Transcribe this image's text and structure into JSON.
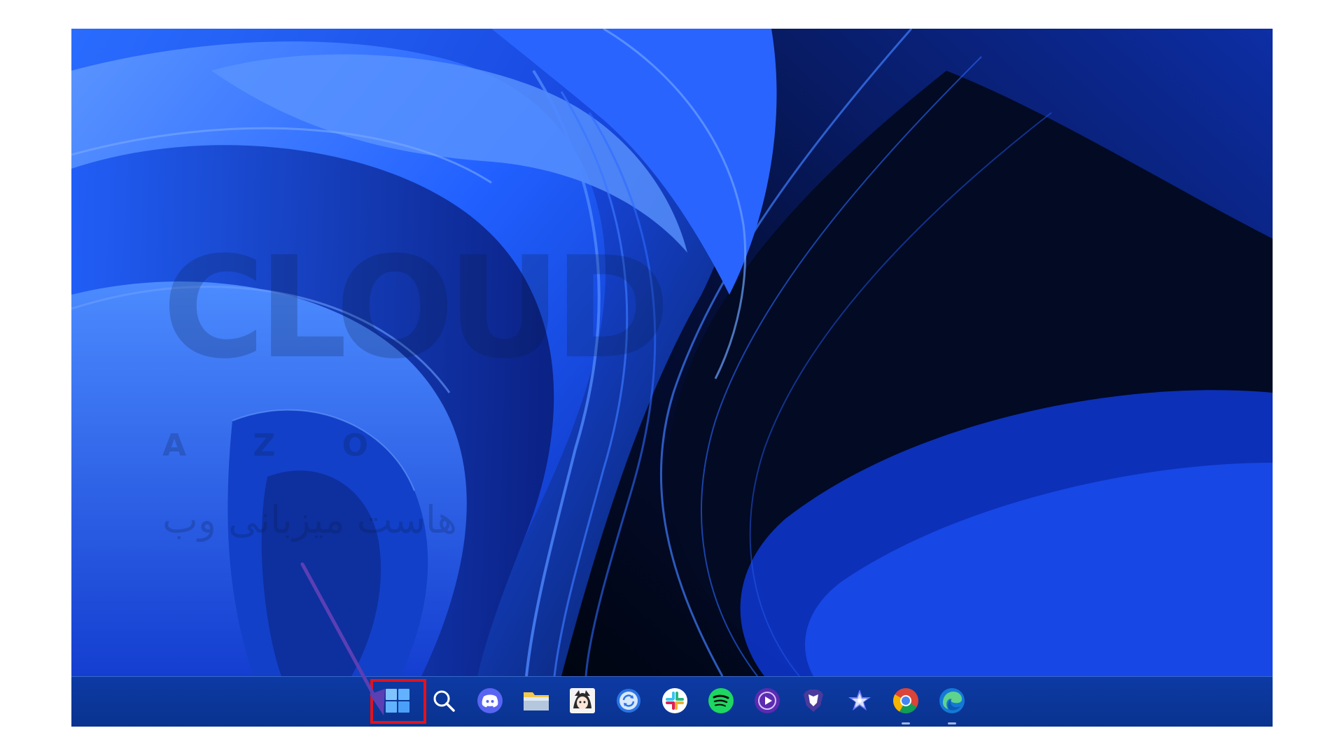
{
  "desktop": {
    "wallpaper": "windows-11-bloom-blue",
    "colors": {
      "wallpaper_light": "#3b7bff",
      "wallpaper_mid": "#1747e0",
      "wallpaper_dark": "#000814",
      "taskbar": "#0b379a",
      "highlight": "#e3121b",
      "arrow": "#5b3fb5"
    }
  },
  "watermark": {
    "logo_text": "CLOUD",
    "sub_text": "A Z O",
    "fa_text": "هاست میزبانی وب"
  },
  "taskbar": {
    "items": [
      {
        "icon": "windows-start-icon",
        "label": "Start"
      },
      {
        "icon": "search-icon",
        "label": "Search"
      },
      {
        "icon": "discord-icon",
        "label": "Discord"
      },
      {
        "icon": "file-explorer-icon",
        "label": "File Explorer"
      },
      {
        "icon": "anime-app-icon",
        "label": "App"
      },
      {
        "icon": "sync-app-icon",
        "label": "Sync"
      },
      {
        "icon": "slack-icon",
        "label": "Slack"
      },
      {
        "icon": "spotify-icon",
        "label": "Spotify"
      },
      {
        "icon": "media-player-icon",
        "label": "Media Player"
      },
      {
        "icon": "brave-icon",
        "label": "Brave"
      },
      {
        "icon": "star-app-icon",
        "label": "App"
      },
      {
        "icon": "chrome-icon",
        "label": "Chrome"
      },
      {
        "icon": "edge-icon",
        "label": "Edge"
      }
    ]
  },
  "annotation": {
    "highlighted_item": "Start"
  }
}
